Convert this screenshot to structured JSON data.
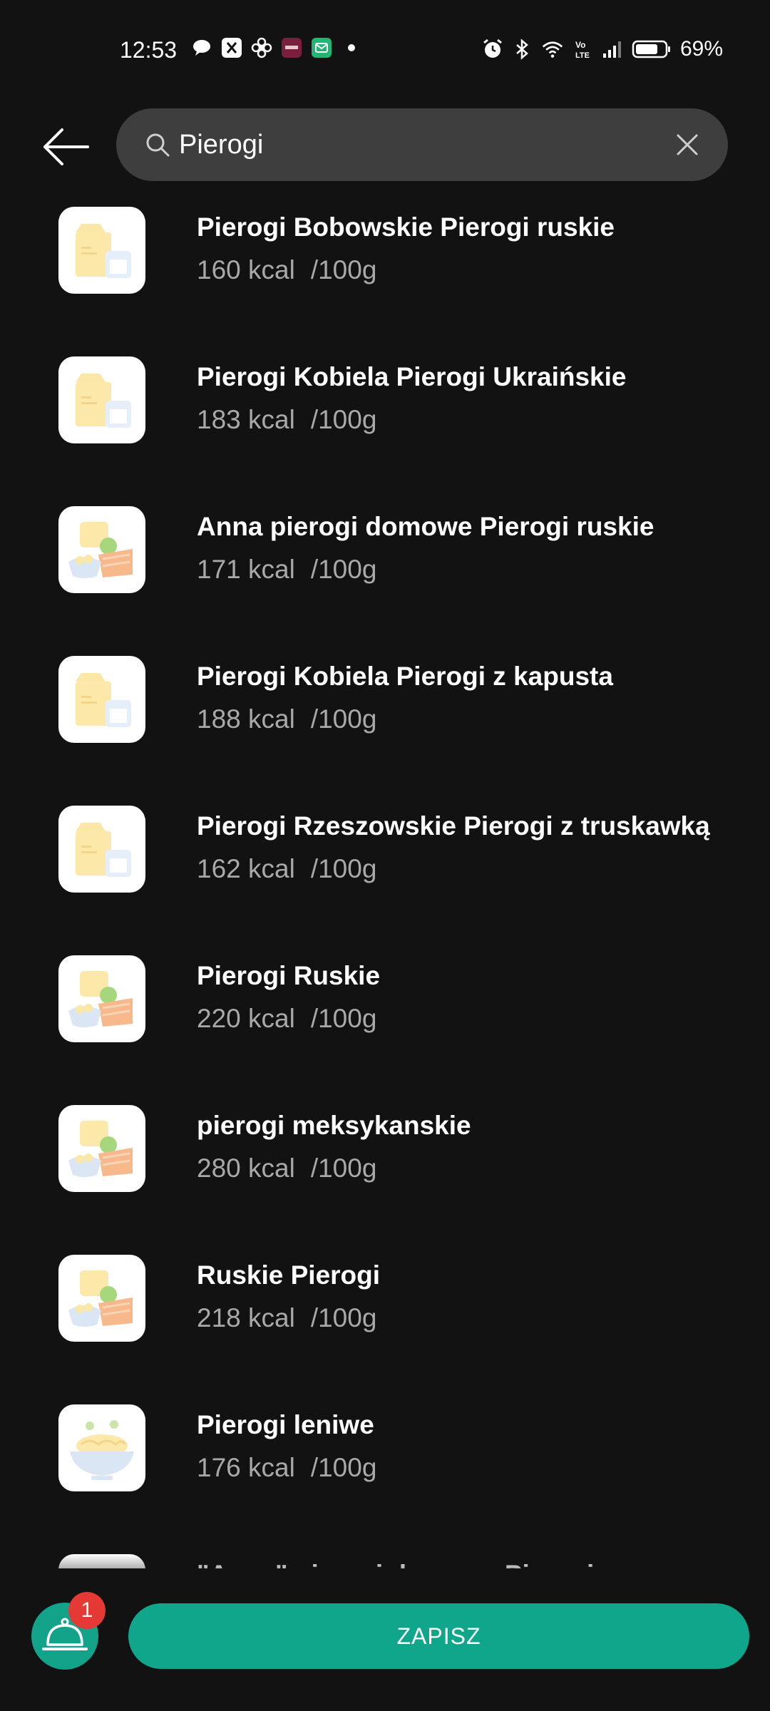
{
  "status_bar": {
    "time": "12:53",
    "battery_percent": "69%",
    "left_icons": [
      "chat-bubble-icon",
      "app-icon",
      "fan-icon",
      "costa-app-icon",
      "mail-app-icon",
      "dot-icon"
    ],
    "right_icons": [
      "alarm-icon",
      "bluetooth-icon",
      "wifi-icon",
      "volte-icon",
      "signal-icon",
      "battery-icon"
    ]
  },
  "search": {
    "value": "Pierogi",
    "placeholder": ""
  },
  "results": [
    {
      "title": "Pierogi Bobowskie Pierogi ruskie",
      "kcal": "160 kcal",
      "unit": "/100g",
      "icon": "dairy-icon"
    },
    {
      "title": "Pierogi Kobiela Pierogi Ukraińskie",
      "kcal": "183 kcal",
      "unit": "/100g",
      "icon": "dairy-icon"
    },
    {
      "title": "Anna pierogi domowe Pierogi ruskie",
      "kcal": "171 kcal",
      "unit": "/100g",
      "icon": "meal-icon"
    },
    {
      "title": "Pierogi Kobiela Pierogi z kapusta",
      "kcal": "188 kcal",
      "unit": "/100g",
      "icon": "dairy-icon"
    },
    {
      "title": "Pierogi Rzeszowskie Pierogi z truskawką",
      "kcal": "162 kcal",
      "unit": "/100g",
      "icon": "dairy-icon"
    },
    {
      "title": "Pierogi Ruskie",
      "kcal": "220 kcal",
      "unit": "/100g",
      "icon": "meal-icon"
    },
    {
      "title": "pierogi meksykanskie",
      "kcal": "280 kcal",
      "unit": "/100g",
      "icon": "meal-icon"
    },
    {
      "title": "Ruskie Pierogi",
      "kcal": "218 kcal",
      "unit": "/100g",
      "icon": "meal-icon"
    },
    {
      "title": "Pierogi leniwe",
      "kcal": "176 kcal",
      "unit": "/100g",
      "icon": "noodle-bowl-icon"
    },
    {
      "title": "\"Anna\" pierogi domowe Pierogi z",
      "kcal": "",
      "unit": "",
      "icon": "meal-icon"
    }
  ],
  "bottom": {
    "badge_count": "1",
    "save_label": "ZAPISZ"
  },
  "colors": {
    "background": "#121212",
    "accent": "#0fa68b",
    "badge": "#e53935",
    "search_bg": "#3e3e3e",
    "secondary_text": "#a9a9a9"
  }
}
